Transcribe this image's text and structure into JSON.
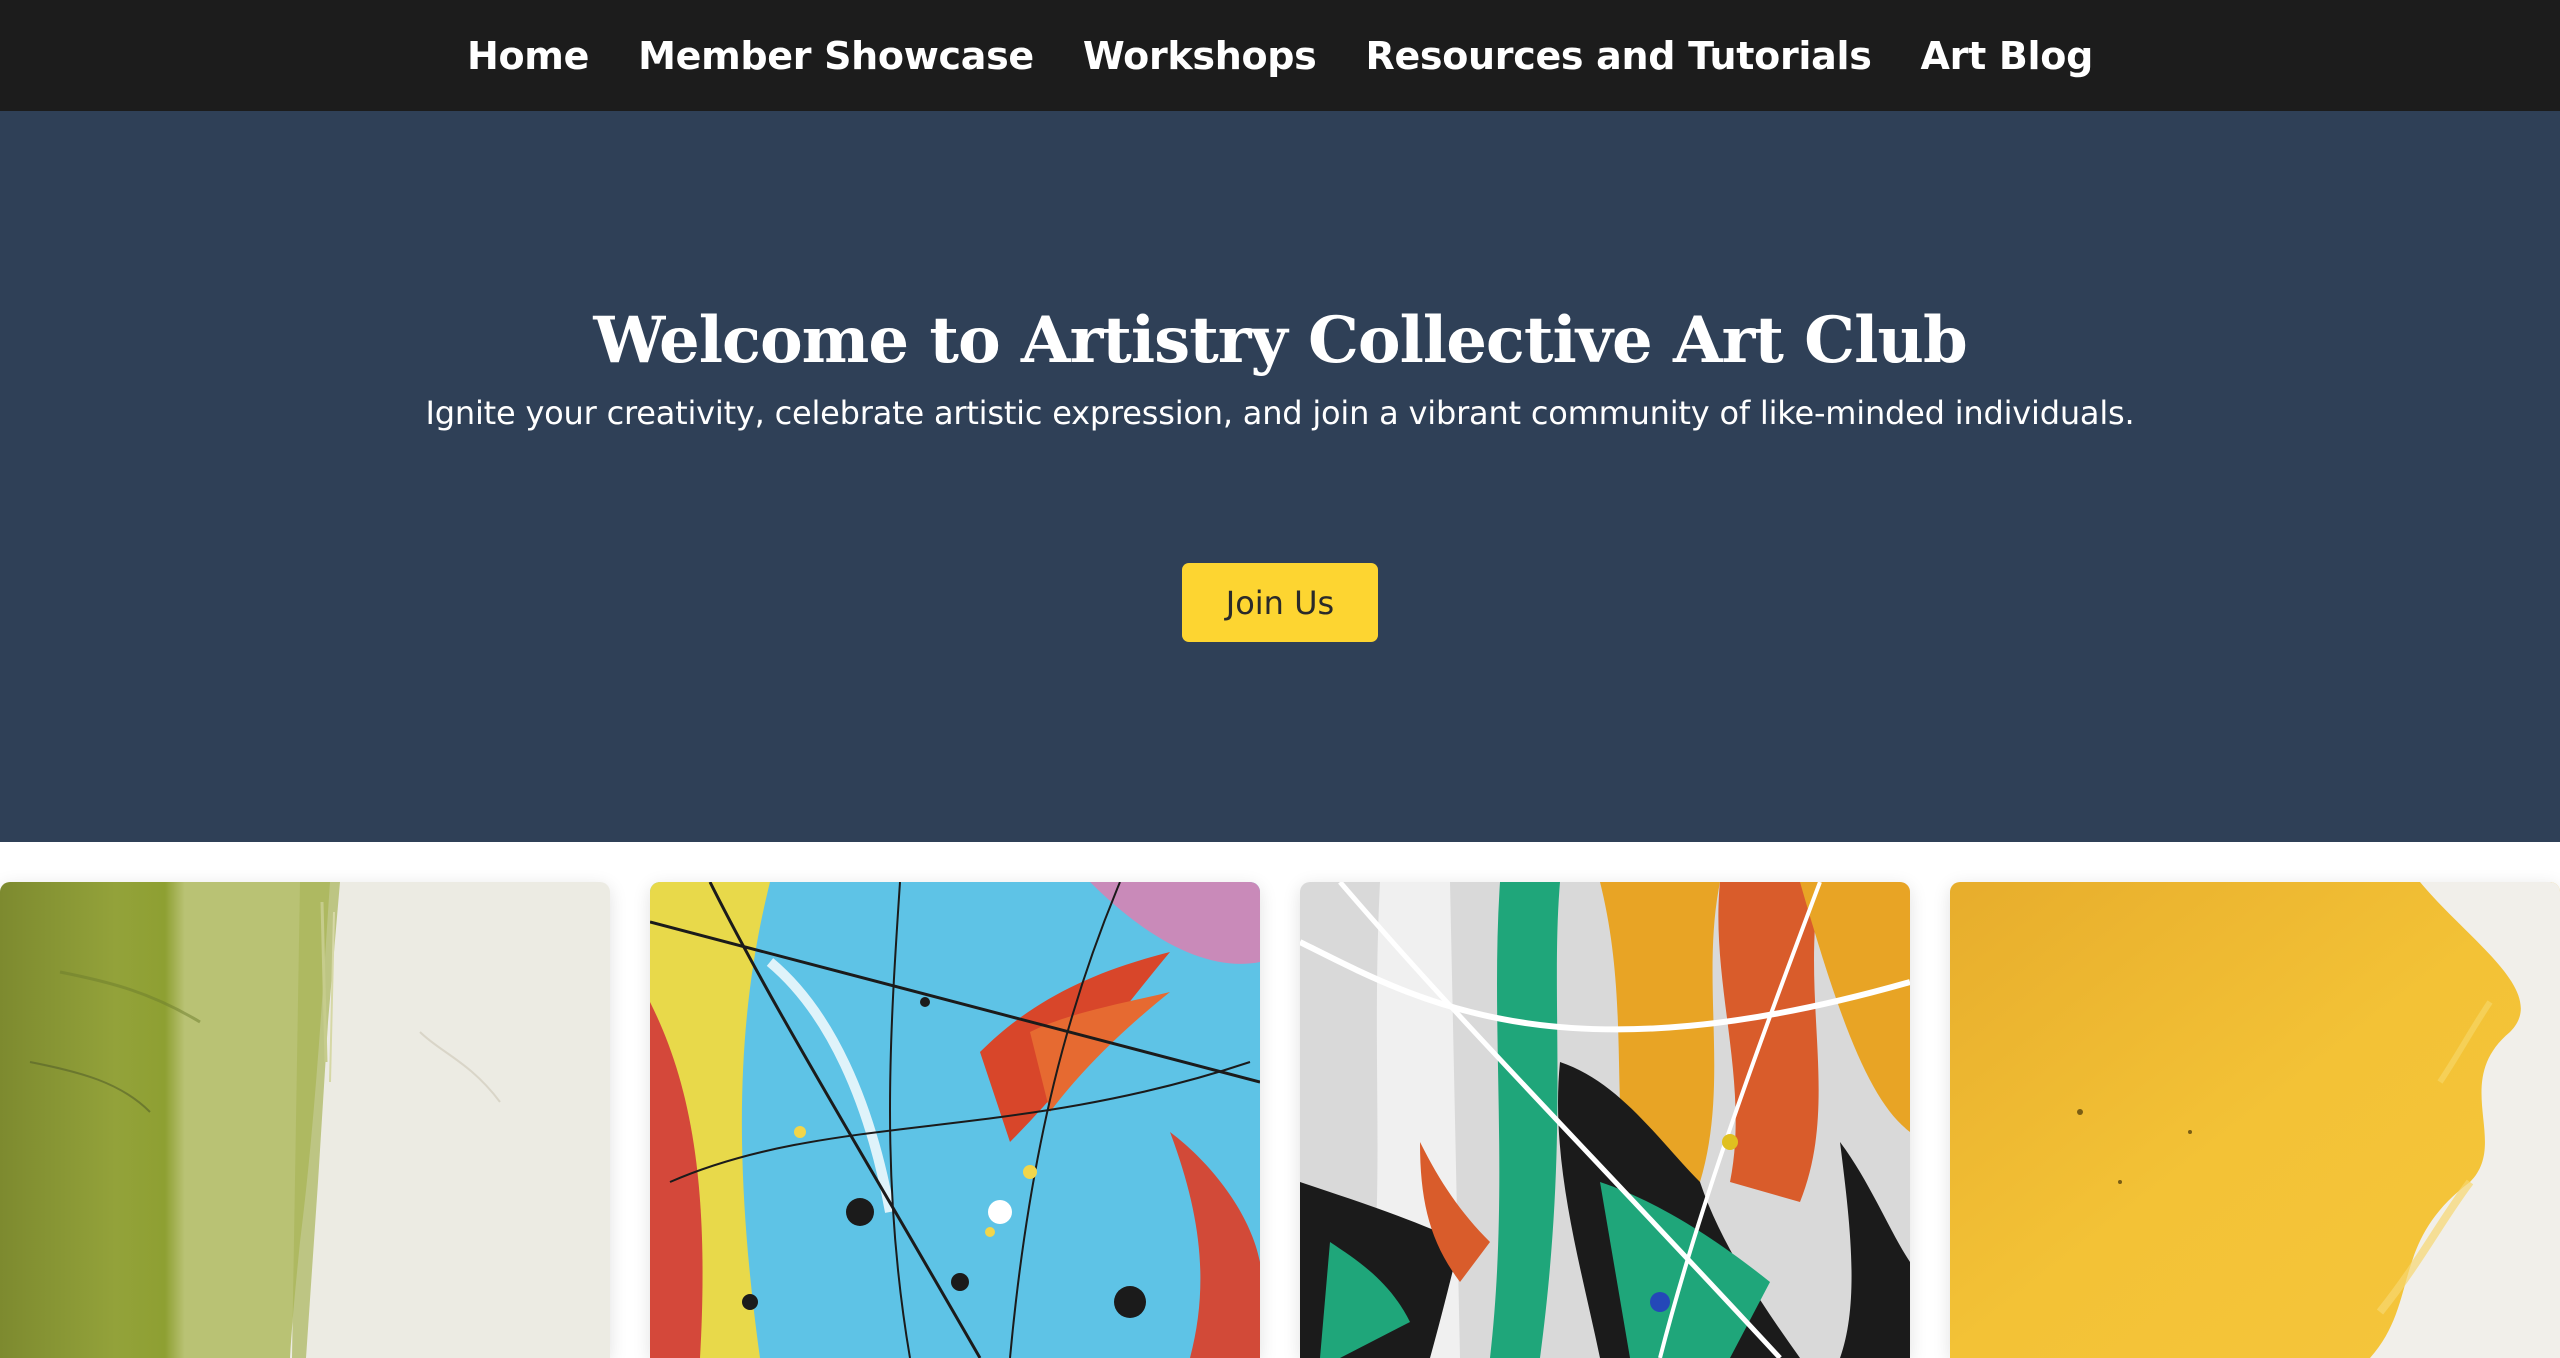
{
  "nav": {
    "items": [
      {
        "label": "Home"
      },
      {
        "label": "Member Showcase"
      },
      {
        "label": "Workshops"
      },
      {
        "label": "Resources and Tutorials"
      },
      {
        "label": "Art Blog"
      }
    ]
  },
  "hero": {
    "title": "Welcome to Artistry Collective Art Club",
    "subtitle": "Ignite your creativity, celebrate artistic expression, and join a vibrant community of like-minded individuals.",
    "cta_label": "Join Us"
  },
  "colors": {
    "nav_background": "#1c1c1c",
    "hero_background": "#2f4057",
    "cta_background": "#fdd531",
    "text_light": "#ffffff"
  },
  "gallery": {
    "cards": [
      {
        "image": "green-white-abstract-painting"
      },
      {
        "image": "blue-splatter-abstract-painting"
      },
      {
        "image": "green-orange-drip-abstract-painting"
      },
      {
        "image": "yellow-white-abstract-painting"
      }
    ]
  }
}
